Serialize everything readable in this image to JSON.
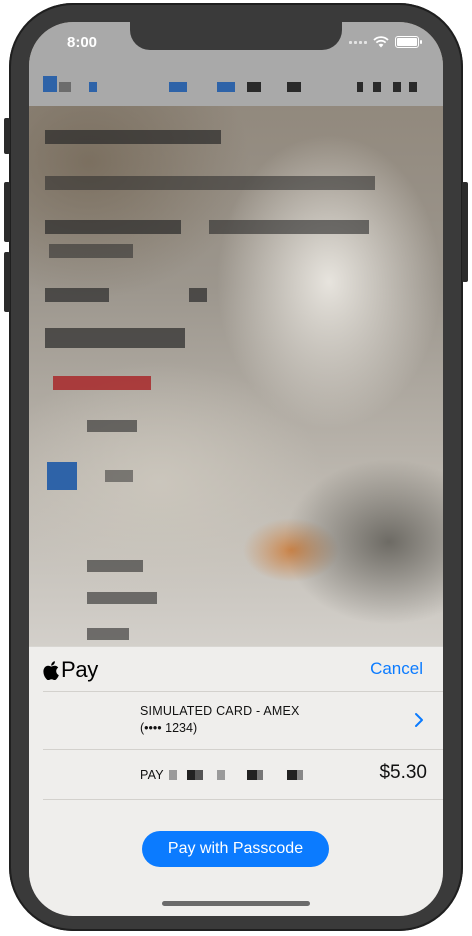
{
  "status_bar": {
    "time": "8:00"
  },
  "apple_pay": {
    "brand": "Pay",
    "cancel_label": "Cancel",
    "card_name": "SIMULATED CARD - AMEX",
    "card_number": "(•••• 1234)",
    "pay_label": "PAY",
    "amount": "$5.30",
    "pay_button_label": "Pay with Passcode"
  },
  "colors": {
    "accent": "#0b7bff",
    "sheet_bg": "#efeeec"
  }
}
